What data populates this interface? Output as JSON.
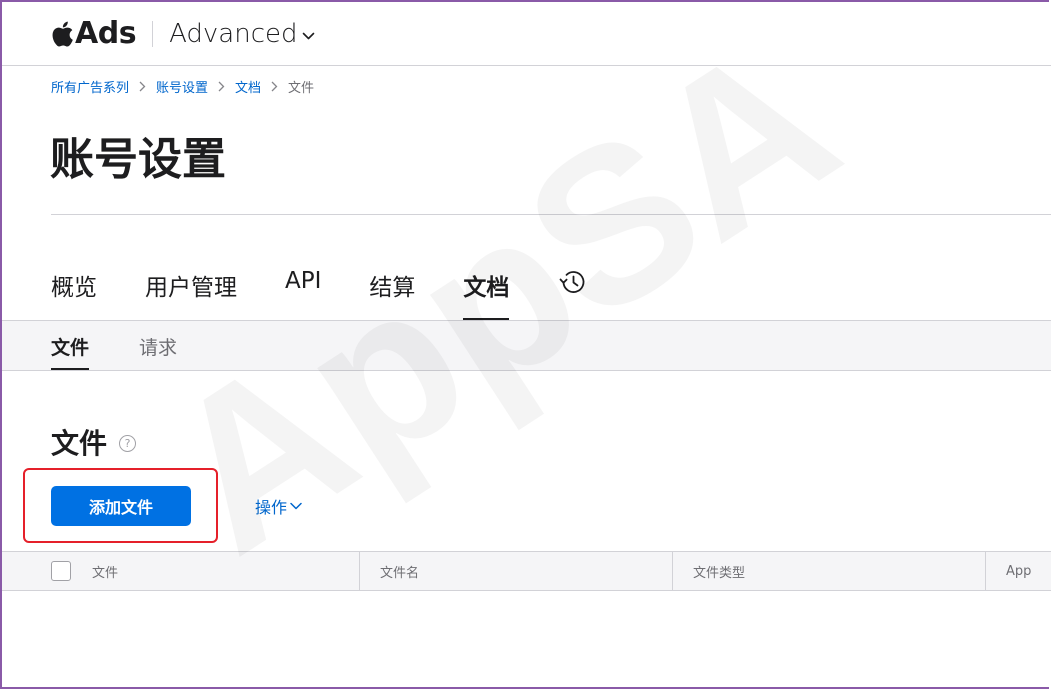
{
  "header": {
    "brand": "Ads",
    "edition": "Advanced"
  },
  "breadcrumb": {
    "items": [
      "所有广告系列",
      "账号设置",
      "文档",
      "文件"
    ]
  },
  "page": {
    "title": "账号设置"
  },
  "main_tabs": {
    "items": [
      "概览",
      "用户管理",
      "API",
      "结算",
      "文档"
    ],
    "active": "文档",
    "history_icon": "history-icon"
  },
  "sub_tabs": {
    "items": [
      "文件",
      "请求"
    ],
    "active": "文件"
  },
  "section": {
    "title": "文件",
    "help_symbol": "?"
  },
  "actions": {
    "add_label": "添加文件",
    "menu_label": "操作"
  },
  "table": {
    "columns": [
      "文件",
      "文件名",
      "文件类型",
      "App"
    ]
  },
  "watermark": {
    "text": "AppSA"
  },
  "colors": {
    "accent": "#0071e3",
    "link": "#0066cc",
    "highlight": "#e5202a",
    "frame": "#8a5aa8"
  }
}
